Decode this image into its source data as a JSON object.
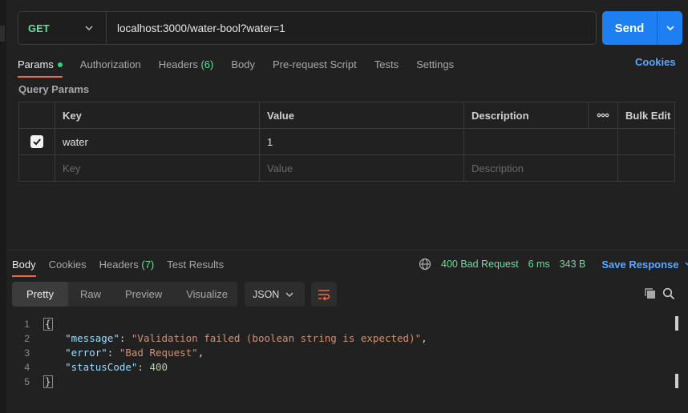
{
  "request": {
    "method": "GET",
    "url": "localhost:3000/water-bool?water=1",
    "send_label": "Send"
  },
  "request_tabs": [
    {
      "label": "Params",
      "active": true,
      "dot": true
    },
    {
      "label": "Authorization"
    },
    {
      "label": "Headers",
      "count": "(6)"
    },
    {
      "label": "Body"
    },
    {
      "label": "Pre-request Script"
    },
    {
      "label": "Tests"
    },
    {
      "label": "Settings"
    }
  ],
  "cookies_label": "Cookies",
  "query_params": {
    "title": "Query Params",
    "headers": {
      "key": "Key",
      "value": "Value",
      "description": "Description",
      "bulk_edit": "Bulk Edit"
    },
    "rows": [
      {
        "checked": true,
        "key": "water",
        "value": "1",
        "description": ""
      }
    ],
    "placeholder": {
      "key": "Key",
      "value": "Value",
      "description": "Description"
    }
  },
  "response_tabs": [
    {
      "label": "Body",
      "active": true
    },
    {
      "label": "Cookies"
    },
    {
      "label": "Headers",
      "count": "(7)"
    },
    {
      "label": "Test Results"
    }
  ],
  "response_status": {
    "status": "400 Bad Request",
    "time": "6 ms",
    "size": "343 B",
    "save_label": "Save Response"
  },
  "view_modes": [
    "Pretty",
    "Raw",
    "Preview",
    "Visualize"
  ],
  "active_view": "Pretty",
  "format": "JSON",
  "code_lines": [
    {
      "n": "1",
      "text": "{"
    },
    {
      "n": "2",
      "key": "\"message\"",
      "value": "\"Validation failed (boolean string is expected)\"",
      "trail": ","
    },
    {
      "n": "3",
      "key": "\"error\"",
      "value": "\"Bad Request\"",
      "trail": ","
    },
    {
      "n": "4",
      "key": "\"statusCode\"",
      "value": "400",
      "trail": ""
    },
    {
      "n": "5",
      "text": "}"
    }
  ],
  "colors": {
    "accent": "#1d7ff1",
    "method_green": "#6bdd9a",
    "tab_underline": "#f26b3a",
    "link_blue": "#5aa8ff"
  }
}
